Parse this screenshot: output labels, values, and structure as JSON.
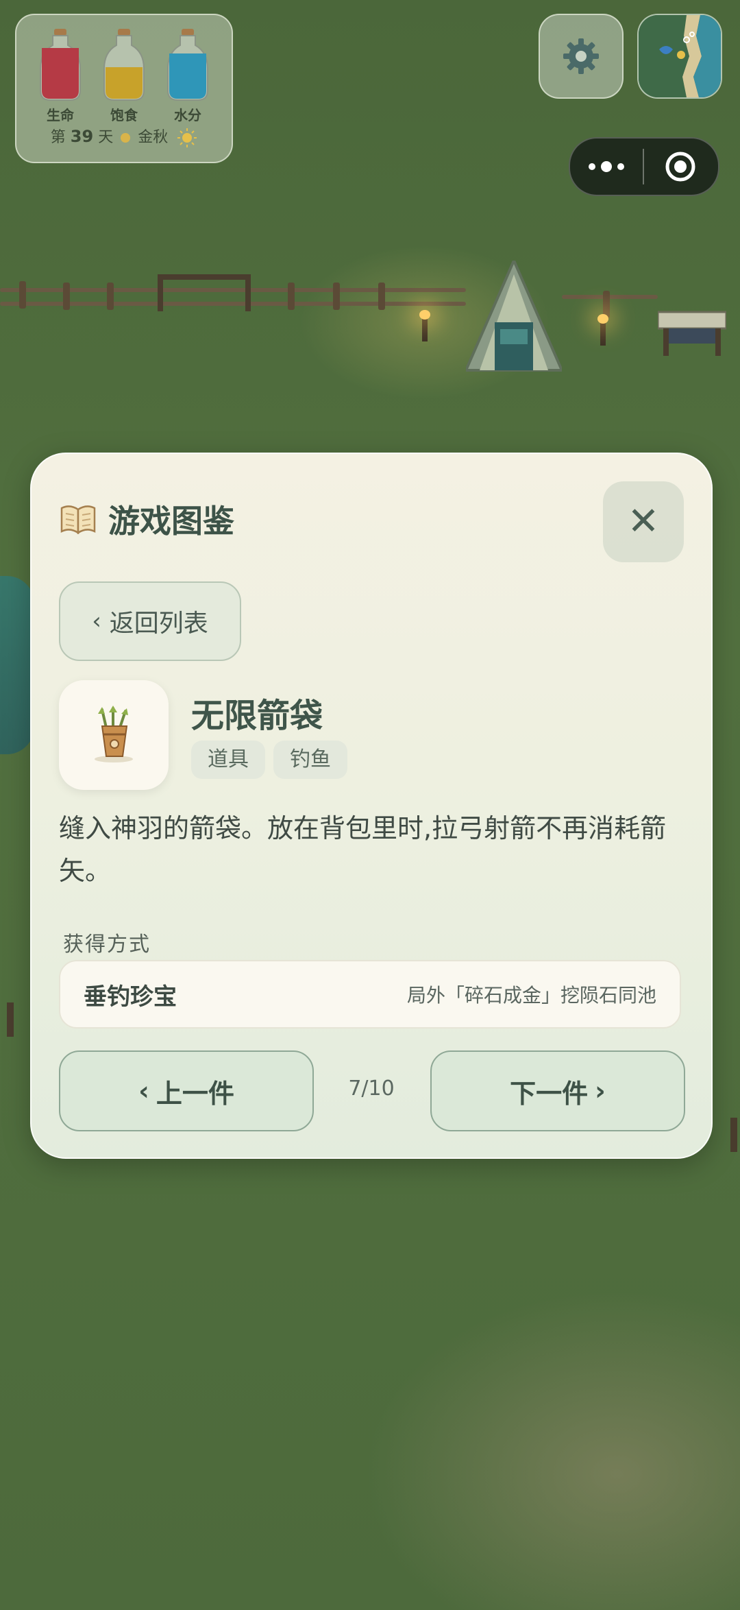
{
  "hud": {
    "bottles": [
      {
        "label": "生命",
        "color": "#b53a45",
        "fill_pct": 80
      },
      {
        "label": "饱食",
        "color": "#c8a22a",
        "fill_pct": 45
      },
      {
        "label": "水分",
        "color": "#2f96b8",
        "fill_pct": 75
      }
    ],
    "day_prefix": "第",
    "day_number": "39",
    "day_suffix": "天",
    "season": "金秋",
    "settings_icon": "gear-icon",
    "map_icon": "minimap-icon"
  },
  "capsule": {
    "more_icon": "more-dots-icon",
    "close_icon": "target-circle-icon"
  },
  "modal": {
    "title": "游戏图鉴",
    "title_icon": "open-book-icon",
    "back_label": "返回列表",
    "item": {
      "name": "无限箭袋",
      "icon": "quiver-icon",
      "tags": [
        "道具",
        "钓鱼"
      ],
      "description": "缝入神羽的箭袋。放在背包里时,拉弓射箭不再消耗箭矢。"
    },
    "source_section_label": "获得方式",
    "source": {
      "name": "垂钓珍宝",
      "detail": "局外「碎石成金」挖陨石同池"
    },
    "prev_label": "上一件",
    "next_label": "下一件",
    "page_indicator": "7/10"
  },
  "colors": {
    "accent": "#3f554a",
    "modal_bg": "#f2f1e4",
    "button_border": "#8fa896"
  }
}
